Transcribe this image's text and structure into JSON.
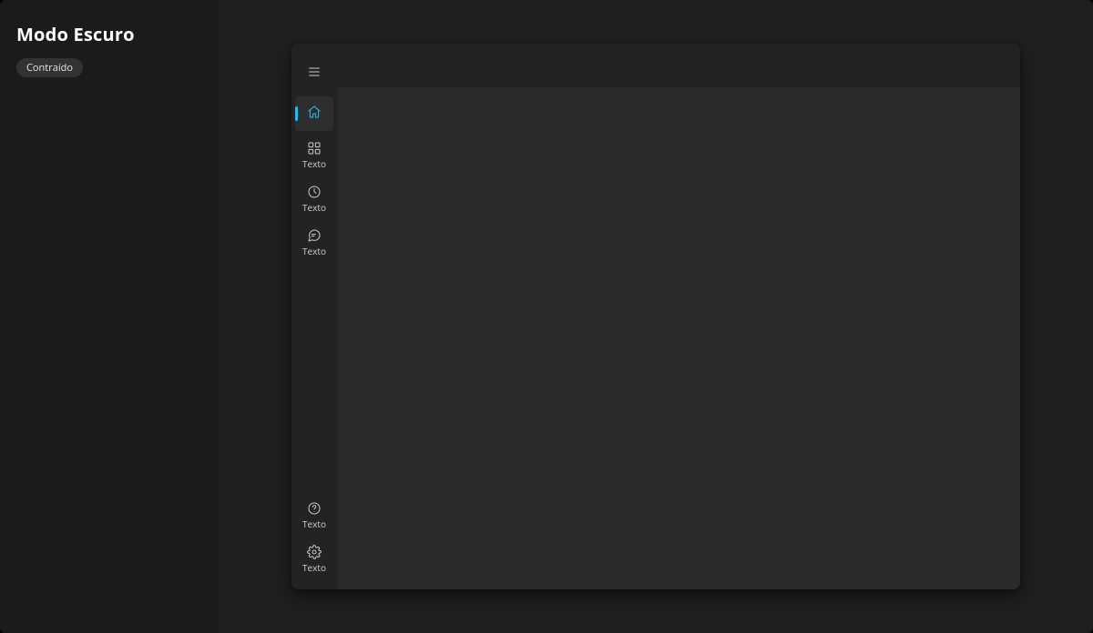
{
  "header": {
    "title": "Modo Escuro",
    "badge": "Contraído"
  },
  "sidebar": {
    "items": [
      {
        "label": "",
        "active": true
      },
      {
        "label": "Texto",
        "active": false
      },
      {
        "label": "Texto",
        "active": false
      },
      {
        "label": "Texto",
        "active": false
      }
    ],
    "footerItems": [
      {
        "label": "Texto"
      },
      {
        "label": "Texto"
      }
    ]
  },
  "colors": {
    "accent": "#25c4ff",
    "sidebarActiveBg": "#2e2e2e",
    "cardBg": "#232323",
    "contentBg": "#2a2a2a"
  }
}
